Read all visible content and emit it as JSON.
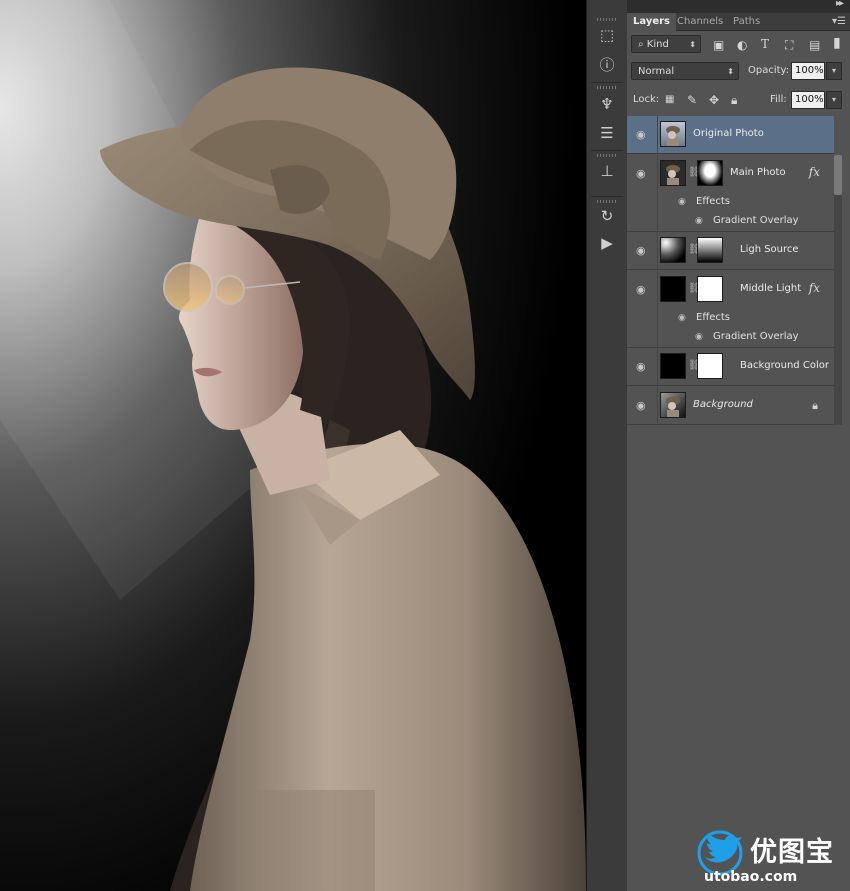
{
  "panel": {
    "tabs": [
      "Layers",
      "Channels",
      "Paths"
    ],
    "active_tab": "Layers",
    "filter": {
      "label": "Kind"
    },
    "blend_mode": "Normal",
    "opacity_label": "Opacity:",
    "opacity_value": "100%",
    "lock_label": "Lock:",
    "fill_label": "Fill:",
    "fill_value": "100%"
  },
  "layers": [
    {
      "name": "Original Photo",
      "selected": true
    },
    {
      "name": "Main Photo",
      "fx": "fx",
      "effects_label": "Effects",
      "effect": "Gradient Overlay"
    },
    {
      "name": "Ligh Source"
    },
    {
      "name": "Middle Light",
      "fx": "fx",
      "effects_label": "Effects",
      "effect": "Gradient Overlay"
    },
    {
      "name": "Background Color"
    },
    {
      "name": "Background",
      "locked": true
    }
  ],
  "watermark": {
    "title": "优图宝",
    "url": "utobao.com"
  },
  "colors": {
    "panel_bg": "#535353",
    "selected_row": "#5c6f88",
    "toolstrip": "#3b3b3b"
  }
}
